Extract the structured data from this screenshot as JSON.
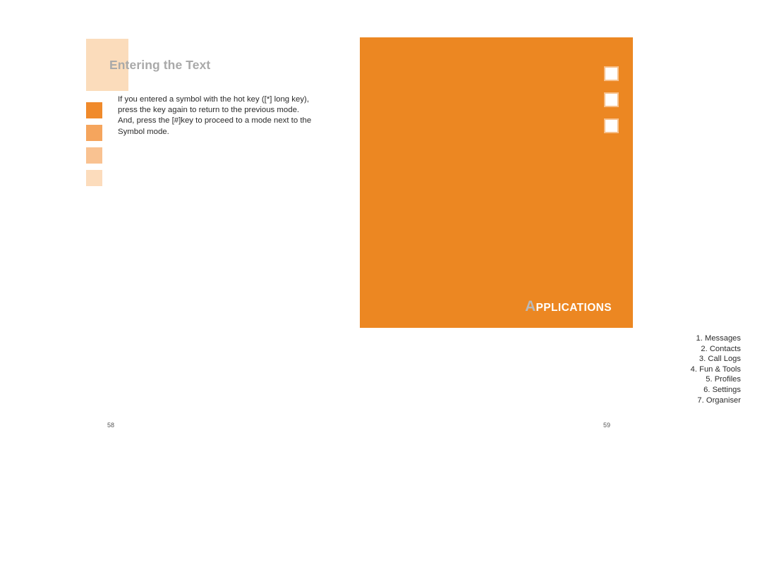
{
  "document": {
    "type": "user-manual-spread",
    "accent_color": "#ec8722",
    "heading_color": "#a9a9a9",
    "body_text_color": "#2b2b2b"
  },
  "left_page": {
    "title": "Entering the Text",
    "body_lines": [
      "If you entered a symbol with the hot key ([*] long key),",
      "press the key again to return to the previous mode.",
      "And, press the [#]key to proceed to a mode next to the",
      "Symbol mode."
    ],
    "page_number": "58",
    "swatches": [
      {
        "name": "swatch-darkest",
        "color": "#f08a2b"
      },
      {
        "name": "swatch-dark",
        "color": "#f5a55d"
      },
      {
        "name": "swatch-light",
        "color": "#f9c291"
      },
      {
        "name": "swatch-lightest",
        "color": "#fcdcbc"
      }
    ],
    "heading_block_color": "#fbdcbb"
  },
  "right_page": {
    "section_title_initial": "A",
    "section_title_rest": "PPLICATIONS",
    "panel_color": "#ec8722",
    "markers": [
      {
        "name": "marker-square-1",
        "color": "#ffffff"
      },
      {
        "name": "marker-square-2",
        "color": "#ffffff"
      },
      {
        "name": "marker-square-3",
        "color": "#ffffff"
      }
    ],
    "toc": [
      {
        "num": "1.",
        "label": "Messages"
      },
      {
        "num": "2.",
        "label": "Contacts"
      },
      {
        "num": "3.",
        "label": "Call Logs"
      },
      {
        "num": "4.",
        "label": "Fun & Tools"
      },
      {
        "num": "5.",
        "label": "Profiles"
      },
      {
        "num": "6.",
        "label": "Settings"
      },
      {
        "num": "7.",
        "label": "Organiser"
      }
    ],
    "page_number": "59"
  }
}
